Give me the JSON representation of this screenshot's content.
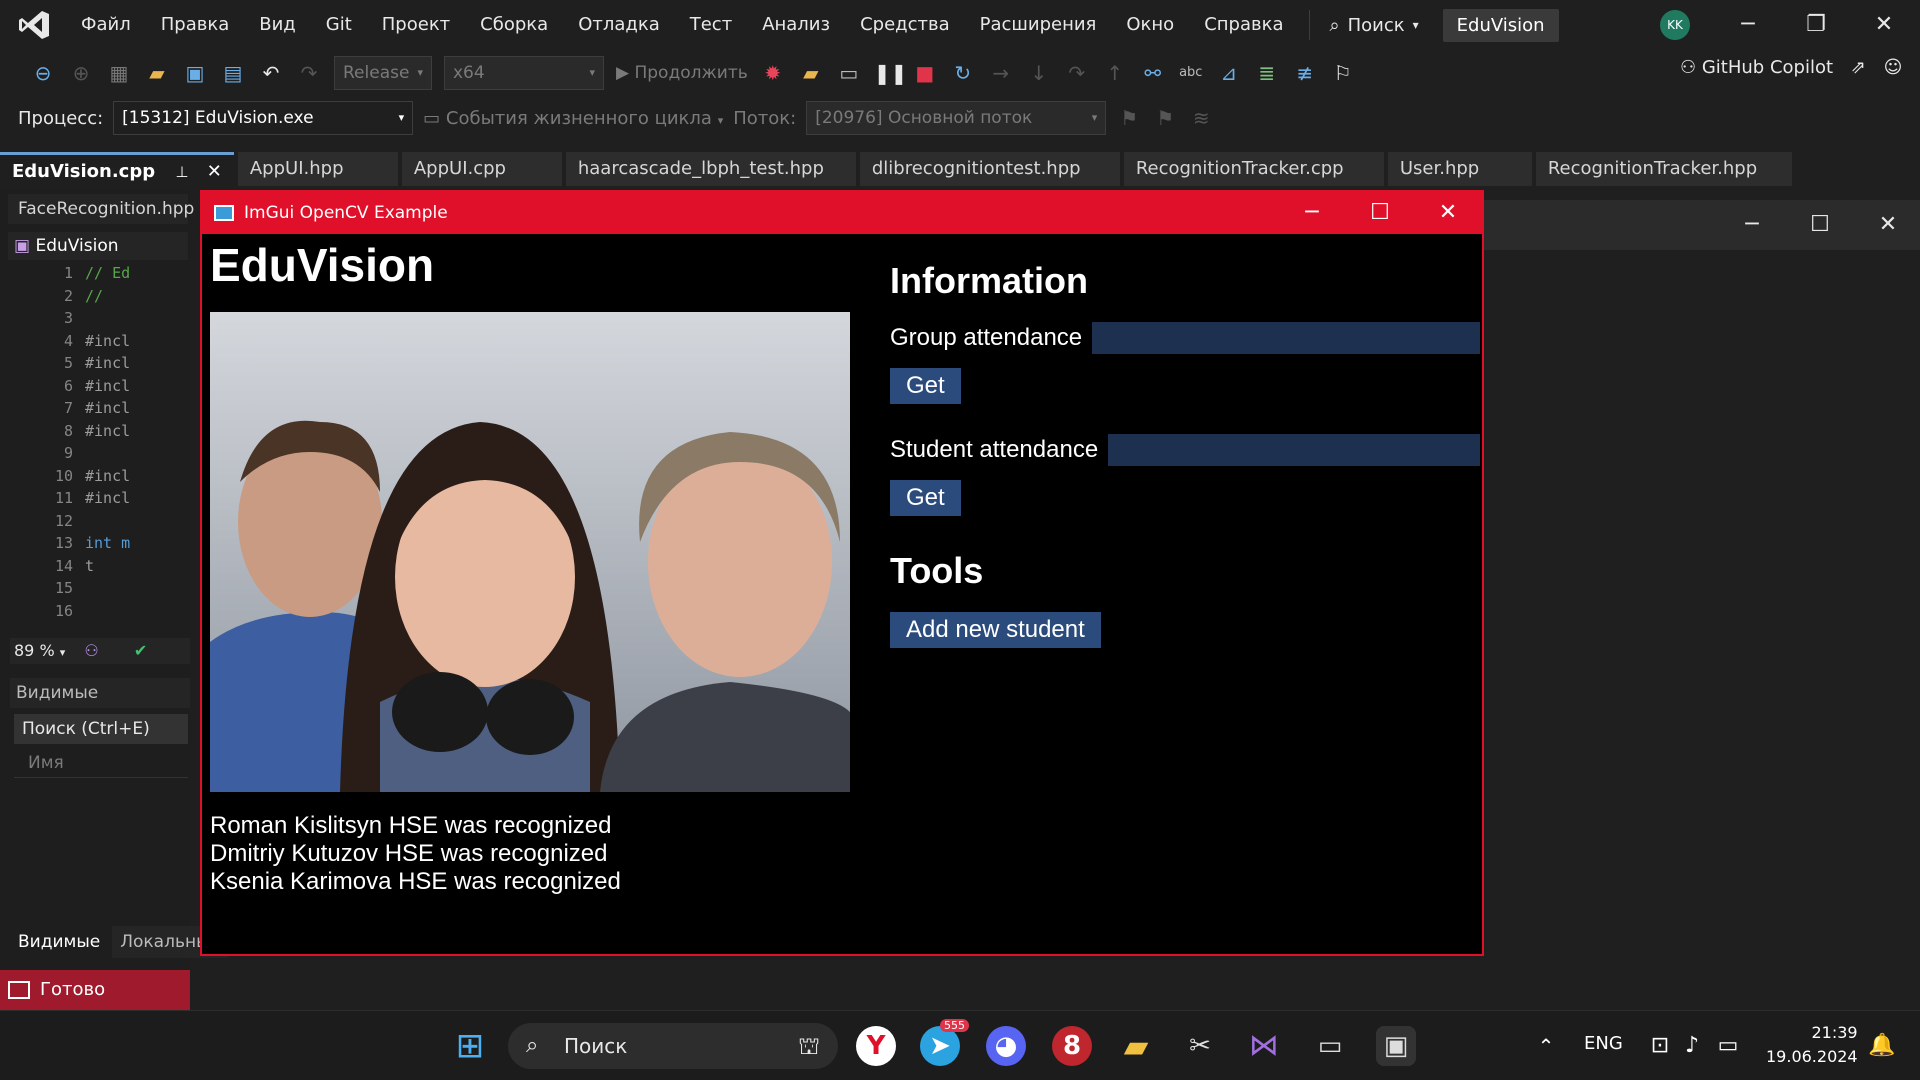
{
  "menubar": {
    "items": [
      "Файл",
      "Правка",
      "Вид",
      "Git",
      "Проект",
      "Сборка",
      "Отладка",
      "Тест",
      "Анализ",
      "Средства",
      "Расширения",
      "Окно",
      "Справка"
    ],
    "search_label": "Поиск",
    "solution_name": "EduVision",
    "avatar_initials": "KK"
  },
  "toolbar1": {
    "config": "Release",
    "platform": "x64",
    "continue_label": "Продолжить",
    "copilot_label": "GitHub Copilot"
  },
  "toolbar2": {
    "process_label": "Процесс:",
    "process_value": "[15312] EduVision.exe",
    "lifecycle_label": "События жизненного цикла",
    "thread_label": "Поток:",
    "thread_value": "[20976] Основной поток"
  },
  "doctabs": [
    "EduVision.cpp",
    "AppUI.hpp",
    "AppUI.cpp",
    "haarcascade_lbph_test.hpp",
    "dlibrecognitiontest.hpp",
    "RecognitionTracker.cpp",
    "User.hpp",
    "RecognitionTracker.hpp"
  ],
  "left_panel": {
    "second_tab": "FaceRecognition.hpp",
    "scope": "EduVision",
    "code_lines": [
      {
        "n": "1",
        "t": "// Ed",
        "c": "cm"
      },
      {
        "n": "2",
        "t": "//",
        "c": "cm"
      },
      {
        "n": "3",
        "t": "",
        "c": ""
      },
      {
        "n": "4",
        "t": "#incl",
        "c": ""
      },
      {
        "n": "5",
        "t": "#incl",
        "c": ""
      },
      {
        "n": "6",
        "t": "#incl",
        "c": ""
      },
      {
        "n": "7",
        "t": "#incl",
        "c": ""
      },
      {
        "n": "8",
        "t": "#incl",
        "c": ""
      },
      {
        "n": "9",
        "t": "",
        "c": ""
      },
      {
        "n": "10",
        "t": "#incl",
        "c": ""
      },
      {
        "n": "11",
        "t": "#incl",
        "c": ""
      },
      {
        "n": "12",
        "t": "",
        "c": ""
      },
      {
        "n": "13",
        "t": "int m",
        "c": "kw"
      },
      {
        "n": "14",
        "t": "   t",
        "c": ""
      },
      {
        "n": "15",
        "t": "",
        "c": ""
      },
      {
        "n": "16",
        "t": "",
        "c": ""
      }
    ],
    "zoom": "89 %",
    "locals_title": "Видимые",
    "locals_search": "Поиск (Ctrl+E)",
    "locals_column": "Имя",
    "bottom_tabs": [
      "Видимые",
      "Локальные"
    ]
  },
  "statusbar": {
    "text": "Готово"
  },
  "imgui": {
    "window_title": "ImGui OpenCV Example",
    "app_title": "EduVision",
    "recognized": [
      "Roman Kislitsyn HSE was recognized",
      "Dmitriy Kutuzov HSE was recognized",
      "Ksenia Karimova HSE was recognized"
    ],
    "info_heading": "Information",
    "group_label": "Group attendance",
    "student_label": "Student attendance",
    "get_label": "Get",
    "tools_heading": "Tools",
    "add_student_label": "Add new student"
  },
  "taskbar": {
    "search_label": "Поиск",
    "lang": "ENG",
    "time": "21:39",
    "date": "19.06.2024",
    "telegram_badge": "555"
  },
  "colors": {
    "imgui_accent": "#e0102a",
    "button": "#2a4b7b",
    "input": "#1d3050"
  }
}
